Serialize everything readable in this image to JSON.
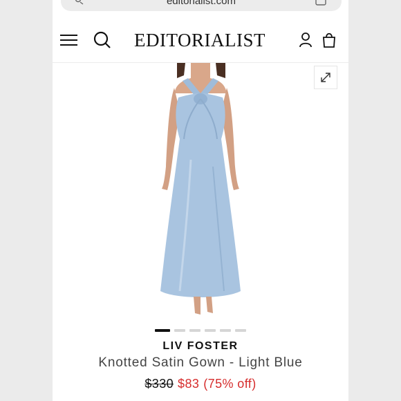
{
  "browser": {
    "url": "editorialist.com"
  },
  "header": {
    "logo_text": "EDITORIALIST",
    "icons": [
      "menu-icon",
      "search-icon",
      "account-icon",
      "bag-icon"
    ]
  },
  "gallery": {
    "image": "light blue satin halter gown on model",
    "slide_count": 6,
    "active_slide": 1
  },
  "product": {
    "brand": "LIV FOSTER",
    "name": "Knotted Satin Gown - Light Blue",
    "original_price": "$330",
    "sale_price": "$83",
    "discount": "(75% off)"
  },
  "colors": {
    "sale": "#d62d2d",
    "dress": "#a9c4e0"
  }
}
